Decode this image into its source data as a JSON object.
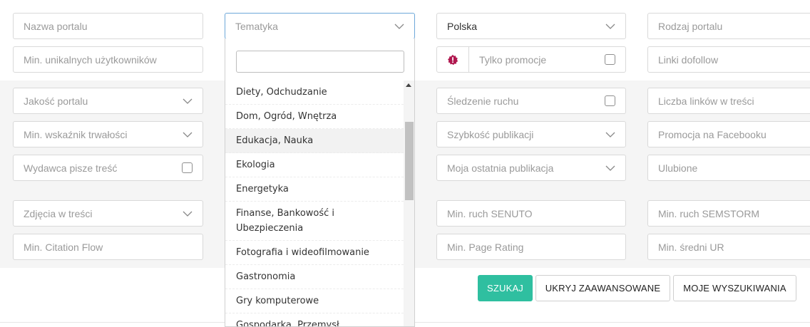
{
  "filters": {
    "row1": {
      "portal_name": "Nazwa portalu",
      "topic": "Tematyka",
      "country": "Polska",
      "portal_type": "Rodzaj portalu"
    },
    "row2": {
      "min_unique_users": "Min. unikalnych użytkowników",
      "only_promotions": "Tylko promocje",
      "dofollow_links": "Linki dofollow"
    },
    "advanced": {
      "portal_quality": "Jakość portalu",
      "traffic_tracking": "Śledzenie ruchu",
      "links_in_content": "Liczba linków w treści",
      "min_durability": "Min. wskaźnik trwałości",
      "publication_speed": "Szybkość publikacji",
      "facebook_promo": "Promocja na Facebooku",
      "publisher_writes": "Wydawca pisze treść",
      "my_last_publication": "Moja ostatnia publikacja",
      "favorites": "Ulubione",
      "images_in_content": "Zdjęcia w treści",
      "min_senuto": "Min. ruch SENUTO",
      "min_semstorm": "Min. ruch SEMSTORM",
      "min_citation_flow": "Min. Citation Flow",
      "min_page_rating": "Min. Page Rating",
      "min_avg_ur": "Min. średni UR"
    }
  },
  "topic_dropdown": {
    "search_value": "",
    "items": [
      "Diety, Odchudzanie",
      "Dom, Ogród, Wnętrza",
      "Edukacja, Nauka",
      "Ekologia",
      "Energetyka",
      "Finanse, Bankowość i Ubezpieczenia",
      "Fotografia i wideofilmowanie",
      "Gastronomia",
      "Gry komputerowe",
      "Gospodarka, Przemysł"
    ],
    "highlighted_index": 2
  },
  "buttons": {
    "search": "SZUKAJ",
    "hide_advanced": "UKRYJ ZAAWANSOWANE",
    "my_searches": "MOJE WYSZUKIWANIA"
  },
  "colors": {
    "accent": "#2fbfa0",
    "promo_icon": "#b0174f"
  }
}
